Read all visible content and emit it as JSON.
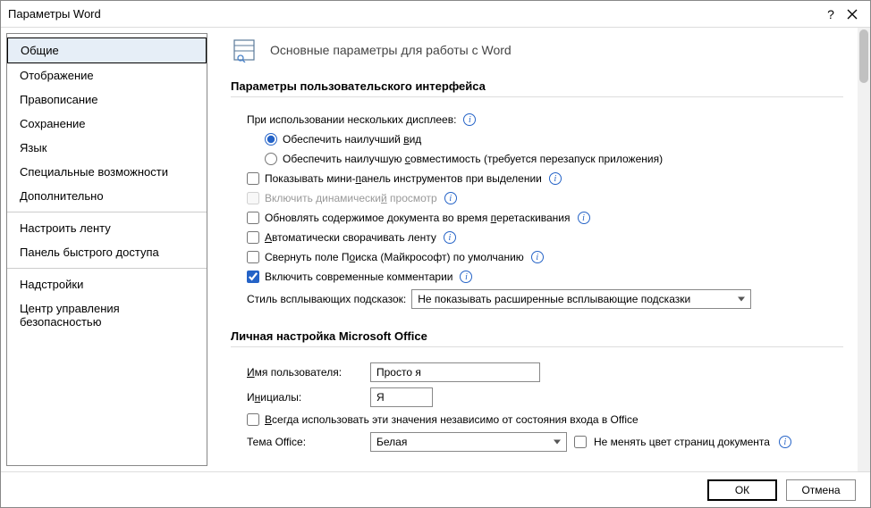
{
  "window": {
    "title": "Параметры Word"
  },
  "sidebar": {
    "items": [
      "Общие",
      "Отображение",
      "Правописание",
      "Сохранение",
      "Язык",
      "Специальные возможности",
      "Дополнительно",
      "Настроить ленту",
      "Панель быстрого доступа",
      "Надстройки",
      "Центр управления безопасностью"
    ]
  },
  "heading": "Основные параметры для работы с Word",
  "section_ui": "Параметры пользовательского интерфейса",
  "multi_display_label": "При использовании нескольких дисплеев:",
  "radio_best_view": "Обеспечить наилучший вид",
  "radio_best_compat": "Обеспечить наилучшую совместимость (требуется перезапуск приложения)",
  "chk_mini_toolbar": "Показывать мини-панель инструментов при выделении",
  "chk_live_preview": "Включить динамический просмотр",
  "chk_update_drag": "Обновлять содержимое документа во время перетаскивания",
  "chk_auto_collapse_ribbon": "Автоматически сворачивать ленту",
  "chk_collapse_search": "Свернуть поле Поиска (Майкрософт) по умолчанию",
  "chk_modern_comments": "Включить современные комментарии",
  "tooltip_style_label": "Стиль всплывающих подсказок:",
  "tooltip_style_value": "Не показывать расширенные всплывающие подсказки",
  "section_personal": "Личная настройка Microsoft Office",
  "username_label": "Имя пользователя:",
  "username_value": "Просто я",
  "initials_label": "Инициалы:",
  "initials_value": "Я",
  "chk_always_use": "Всегда использовать эти значения независимо от состояния входа в Office",
  "theme_label": "Тема Office:",
  "theme_value": "Белая",
  "chk_no_change_page_color": "Не менять цвет страниц документа",
  "footer": {
    "ok": "ОК",
    "cancel": "Отмена"
  }
}
